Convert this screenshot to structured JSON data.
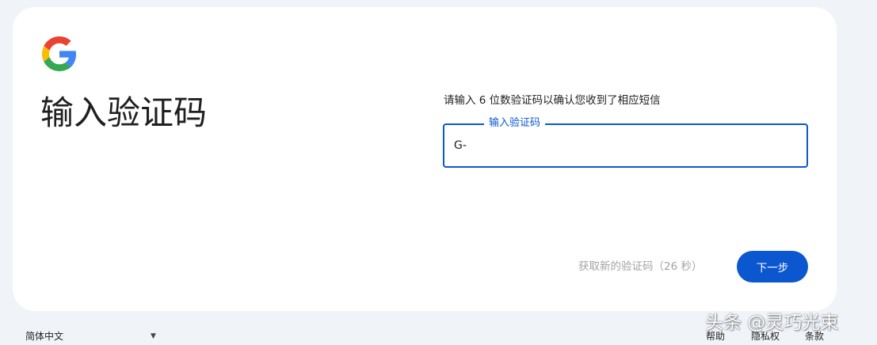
{
  "brand": {
    "logo_icon": "google-g-icon",
    "colors": {
      "blue": "#4285F4",
      "red": "#EA4335",
      "yellow": "#FBBC05",
      "green": "#34A853"
    }
  },
  "header": {
    "title": "输入验证码"
  },
  "form": {
    "instruction": "请输入 6 位数验证码以确认您收到了相应短信",
    "code_field": {
      "label": "输入验证码",
      "value": "G-"
    },
    "resend_link": "获取新的验证码（26 秒）",
    "next_button": "下一步",
    "accent_color": "#0b57d0"
  },
  "footer": {
    "language": "简体中文",
    "language_icon": "caret-down-icon",
    "links": {
      "help": "帮助",
      "privacy": "隐私权",
      "terms": "条款"
    }
  },
  "watermark": {
    "text": "头条 @灵巧光束"
  }
}
